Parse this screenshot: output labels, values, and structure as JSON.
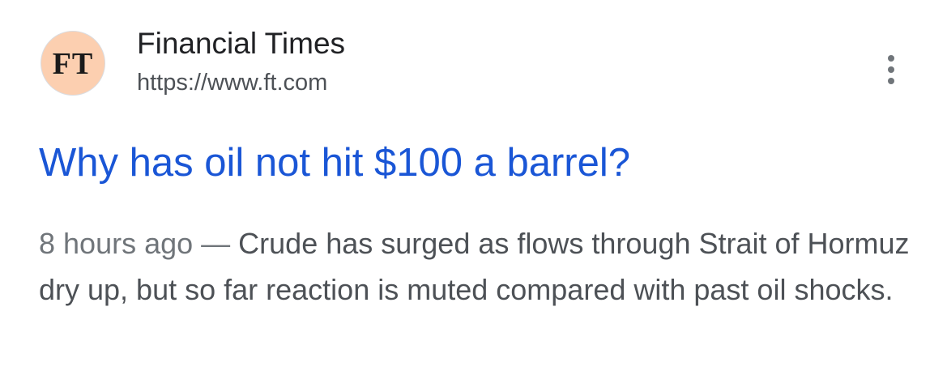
{
  "source": {
    "favicon_text": "FT",
    "favicon_color": "#fccfb0",
    "name": "Financial Times",
    "url": "https://www.ft.com",
    "more_icon": "more-vert-icon"
  },
  "result": {
    "title": "Why has oil not hit $100 a barrel?",
    "title_color": "#1a56d6",
    "date": "8 hours ago",
    "separator": " — ",
    "snippet": "Crude has surged as flows through Strait of Hormuz dry up, but so far reaction is muted compared with past oil shocks."
  }
}
